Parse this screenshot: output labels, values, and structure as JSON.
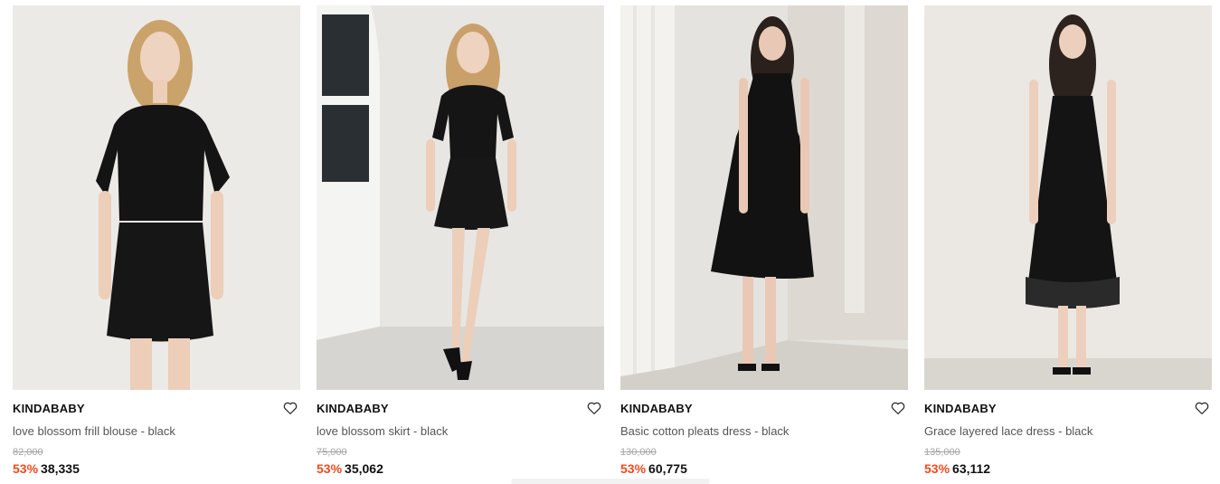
{
  "products": [
    {
      "brand": "KINDABABY",
      "name": "love blossom frill blouse - black",
      "original_price": "82,000",
      "discount": "53%",
      "sale_price": "38,335",
      "image_alt": "model wearing black frill blouse and black mini skirt"
    },
    {
      "brand": "KINDABABY",
      "name": "love blossom skirt - black",
      "original_price": "75,000",
      "discount": "53%",
      "sale_price": "35,062",
      "image_alt": "model wearing black puff-sleeve top and mini skirt by a white door"
    },
    {
      "brand": "KINDABABY",
      "name": "Basic cotton pleats dress - black",
      "original_price": "130,000",
      "discount": "53%",
      "sale_price": "60,775",
      "image_alt": "model wearing black sleeveless pleated dress"
    },
    {
      "brand": "KINDABABY",
      "name": "Grace layered lace dress - black",
      "original_price": "135,000",
      "discount": "53%",
      "sale_price": "63,112",
      "image_alt": "model wearing black lace slip dress"
    }
  ],
  "colors": {
    "discount": "#f2491d",
    "brand_text": "#111111",
    "name_text": "#555555",
    "original_price_text": "#a5a5a5",
    "photo_background": "#e9e8e5"
  },
  "icons": {
    "wishlist": "heart-outline-icon"
  }
}
